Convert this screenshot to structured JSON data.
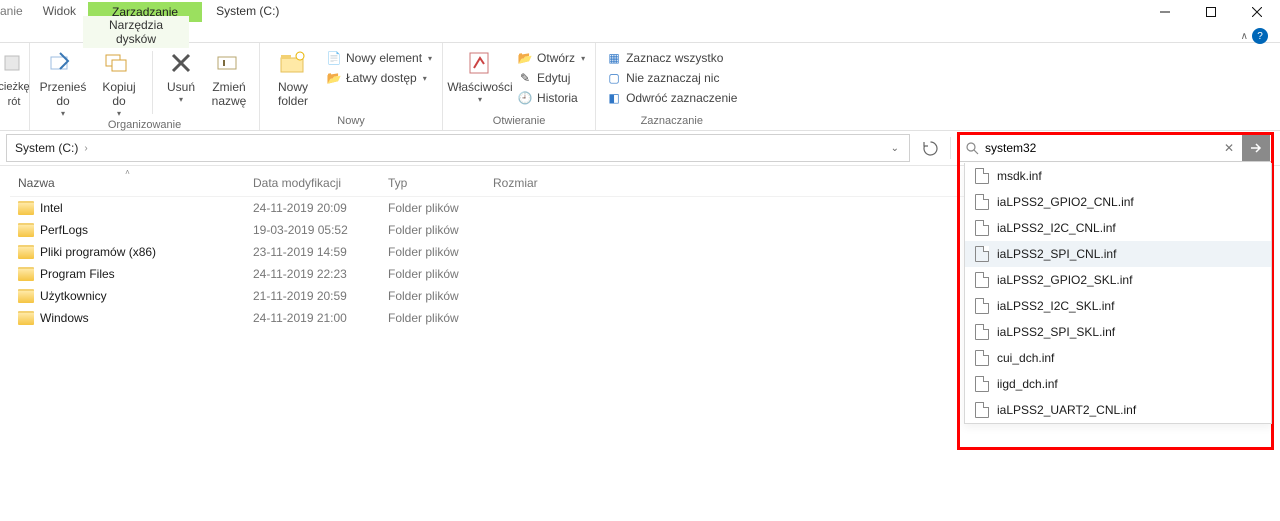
{
  "window": {
    "title": "System (C:)"
  },
  "tabs": {
    "left_partial": "anie",
    "view": "Widok",
    "manage": "Zarządzanie",
    "sub_left_partial": "cieżkę",
    "sub_tools": "Narzędzia dysków",
    "sub_rot": "rót"
  },
  "ribbon": {
    "org": {
      "move": "Przenieś do",
      "copy": "Kopiuj do",
      "delete": "Usuń",
      "rename": "Zmień nazwę",
      "group": "Organizowanie"
    },
    "new_group": {
      "new_folder": "Nowy folder",
      "new_item": "Nowy element",
      "easy_access": "Łatwy dostęp",
      "group": "Nowy"
    },
    "open_group": {
      "properties": "Właściwości",
      "open": "Otwórz",
      "edit": "Edytuj",
      "history": "Historia",
      "group": "Otwieranie"
    },
    "select_group": {
      "select_all": "Zaznacz wszystko",
      "select_none": "Nie zaznaczaj nic",
      "invert": "Odwróć zaznaczenie",
      "group": "Zaznaczanie"
    }
  },
  "address": {
    "crumb1": "System (C:)"
  },
  "search": {
    "value": "system32",
    "placeholder": ""
  },
  "columns": {
    "name": "Nazwa",
    "date": "Data modyfikacji",
    "type": "Typ",
    "size": "Rozmiar"
  },
  "rows": [
    {
      "name": "Intel",
      "date": "24-11-2019 20:09",
      "type": "Folder plików"
    },
    {
      "name": "PerfLogs",
      "date": "19-03-2019 05:52",
      "type": "Folder plików"
    },
    {
      "name": "Pliki programów (x86)",
      "date": "23-11-2019 14:59",
      "type": "Folder plików"
    },
    {
      "name": "Program Files",
      "date": "24-11-2019 22:23",
      "type": "Folder plików"
    },
    {
      "name": "Użytkownicy",
      "date": "21-11-2019 20:59",
      "type": "Folder plików"
    },
    {
      "name": "Windows",
      "date": "24-11-2019 21:00",
      "type": "Folder plików"
    }
  ],
  "suggestions": [
    {
      "name": "msdk.inf"
    },
    {
      "name": "iaLPSS2_GPIO2_CNL.inf"
    },
    {
      "name": "iaLPSS2_I2C_CNL.inf"
    },
    {
      "name": "iaLPSS2_SPI_CNL.inf",
      "hover": true
    },
    {
      "name": "iaLPSS2_GPIO2_SKL.inf"
    },
    {
      "name": "iaLPSS2_I2C_SKL.inf"
    },
    {
      "name": "iaLPSS2_SPI_SKL.inf"
    },
    {
      "name": "cui_dch.inf"
    },
    {
      "name": "iigd_dch.inf"
    },
    {
      "name": "iaLPSS2_UART2_CNL.inf"
    }
  ]
}
